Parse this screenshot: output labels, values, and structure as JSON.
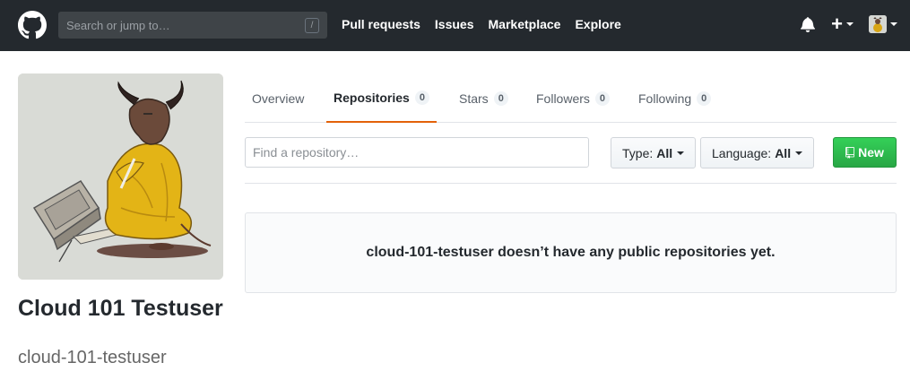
{
  "header": {
    "search_placeholder": "Search or jump to…",
    "search_shortcut": "/",
    "nav": [
      "Pull requests",
      "Issues",
      "Marketplace",
      "Explore"
    ],
    "plus_label": "+"
  },
  "profile": {
    "full_name": "Cloud 101 Testuser",
    "login": "cloud-101-testuser"
  },
  "tabs": [
    {
      "label": "Overview",
      "count": null
    },
    {
      "label": "Repositories",
      "count": "0"
    },
    {
      "label": "Stars",
      "count": "0"
    },
    {
      "label": "Followers",
      "count": "0"
    },
    {
      "label": "Following",
      "count": "0"
    }
  ],
  "filters": {
    "find_placeholder": "Find a repository…",
    "type_label": "Type:",
    "type_value": "All",
    "language_label": "Language:",
    "language_value": "All",
    "new_label": "New"
  },
  "blankslate": {
    "message": "cloud-101-testuser doesn’t have any public repositories yet."
  },
  "colors": {
    "header_bg": "#24292e",
    "accent_tab": "#e36209",
    "new_button": "#28a745"
  }
}
